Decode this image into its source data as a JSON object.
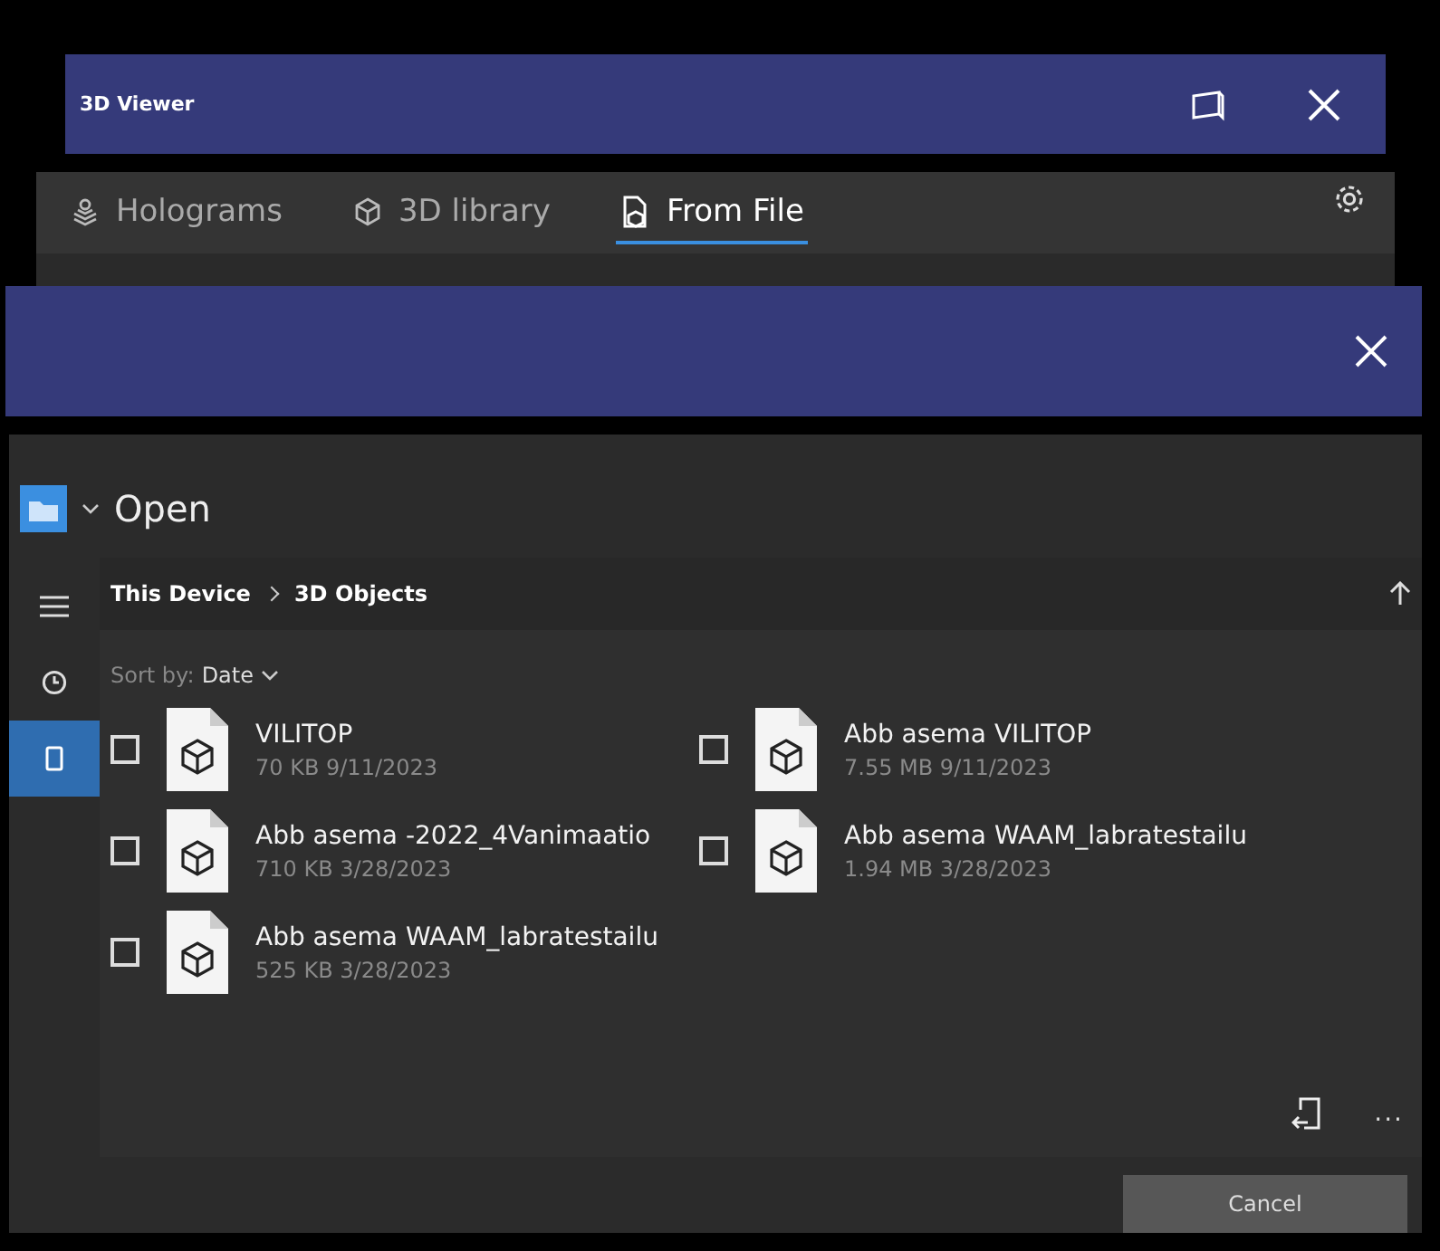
{
  "window": {
    "title": "3D Viewer"
  },
  "tabs": [
    {
      "label": "Holograms",
      "kind": "holograms",
      "selected": false
    },
    {
      "label": "3D library",
      "kind": "library",
      "selected": false
    },
    {
      "label": "From File",
      "kind": "file",
      "selected": true
    }
  ],
  "dialog": {
    "title": "Open",
    "nav": [
      {
        "kind": "menu",
        "selected": false
      },
      {
        "kind": "recent",
        "selected": false
      },
      {
        "kind": "device",
        "selected": true
      }
    ],
    "breadcrumb": [
      "This Device",
      "3D Objects"
    ],
    "sort": {
      "label": "Sort by:",
      "value": "Date"
    },
    "files": [
      {
        "name": "VILITOP",
        "meta": "70 KB 9/11/2023",
        "checked": false
      },
      {
        "name": "Abb asema VILITOP",
        "meta": "7.55 MB 9/11/2023",
        "checked": false
      },
      {
        "name": "Abb asema -2022_4Vanimaatio",
        "meta": "710 KB 3/28/2023",
        "checked": false
      },
      {
        "name": "Abb asema WAAM_labratestailu",
        "meta": "1.94 MB 3/28/2023",
        "checked": false
      },
      {
        "name": "Abb asema WAAM_labratestailu",
        "meta": "525 KB 3/28/2023",
        "checked": false
      }
    ],
    "toolbar": [
      "..."
    ],
    "buttons": [
      {
        "label": "Cancel"
      }
    ]
  }
}
